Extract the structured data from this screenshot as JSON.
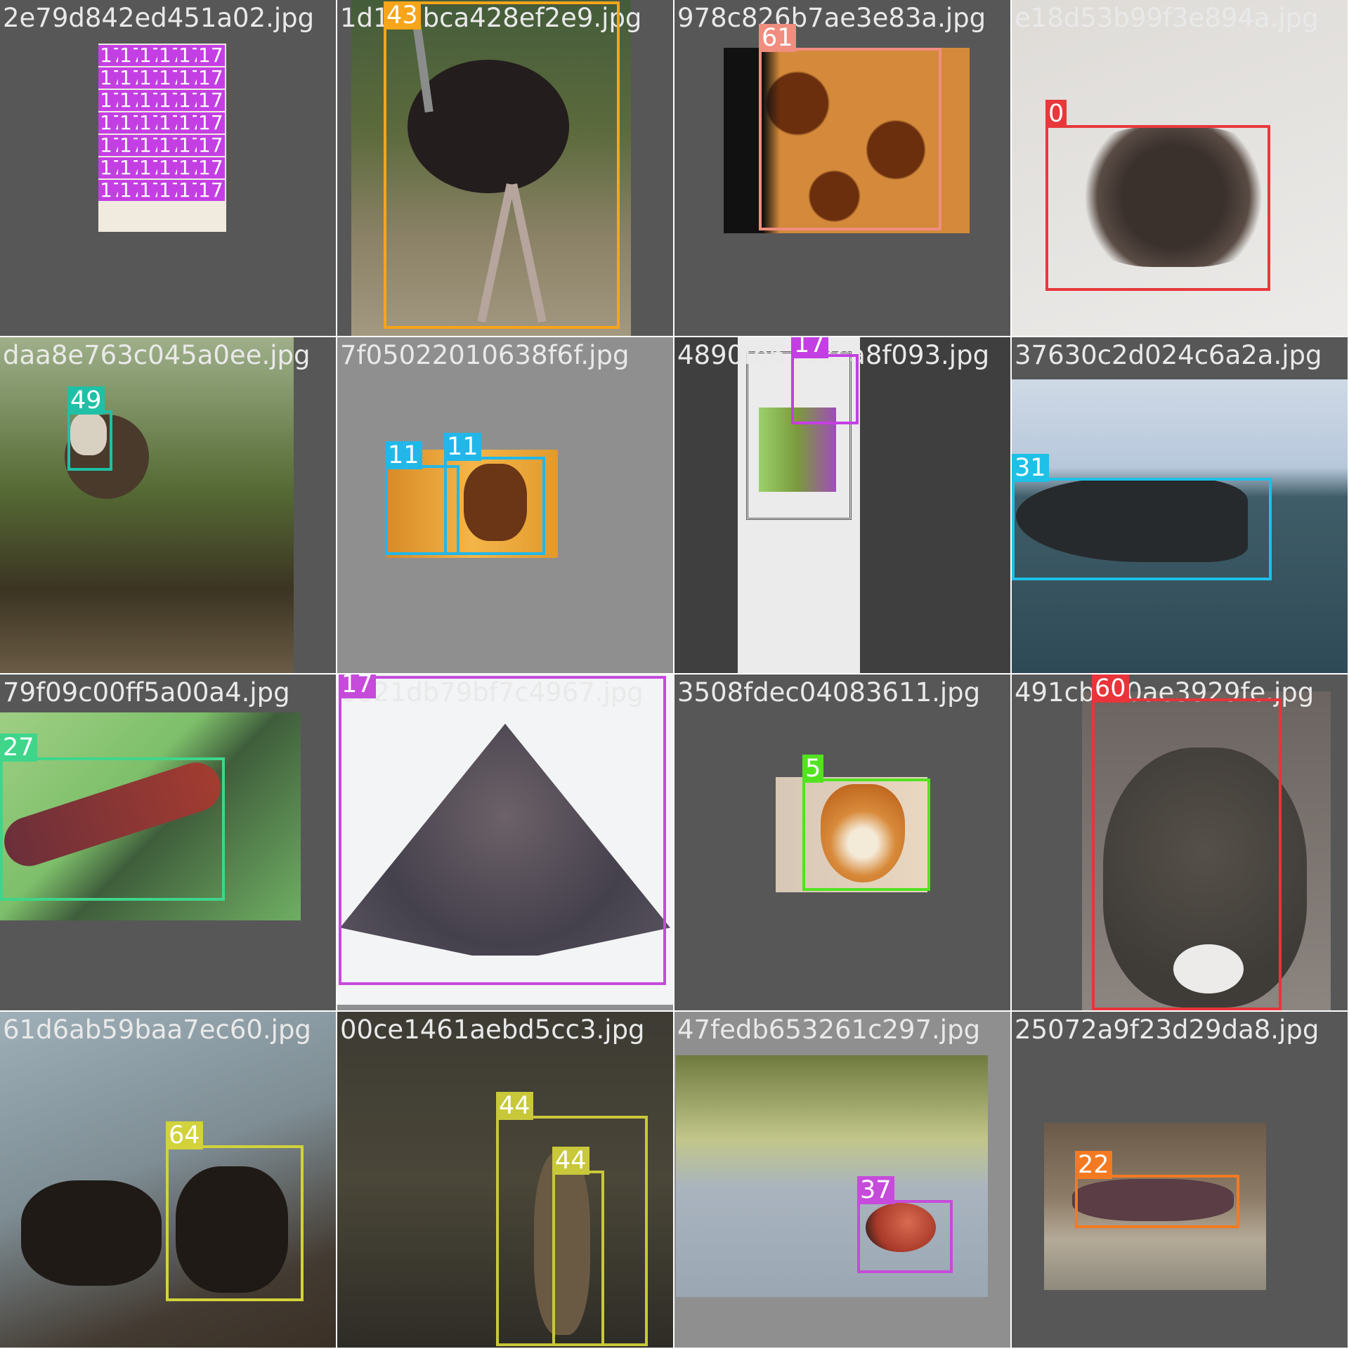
{
  "mosaic": {
    "tiles": [
      {
        "filename": "2e79d842ed451a02.jpg",
        "photo": "page of butterfly specimen images",
        "labels": [
          "17",
          "17",
          "17",
          "17",
          "17",
          "17",
          "17",
          "17",
          "17",
          "17",
          "17",
          "17",
          "17",
          "17",
          "17",
          "17",
          "17",
          "17",
          "17",
          "17",
          "17",
          "17",
          "17",
          "17",
          "17",
          "17",
          "17",
          "17",
          "17",
          "17",
          "17",
          "17",
          "17",
          "17",
          "17",
          "17",
          "17",
          "17",
          "17",
          "17",
          "17",
          "17",
          "17",
          "17"
        ]
      },
      {
        "filename": "1d143bca428ef2e9.jpg",
        "photo": "ostrich",
        "labels": [
          "43"
        ]
      },
      {
        "filename": "978c826b7ae3e83a.jpg",
        "photo": "giraffe skin pattern",
        "labels": [
          "61"
        ]
      },
      {
        "filename": "e18d53b99f3e894a.jpg",
        "photo": "tarantula",
        "labels": [
          "0"
        ]
      },
      {
        "filename": "daa8e763c045a0ee.jpg",
        "photo": "snail on dried flower",
        "labels": [
          "49"
        ]
      },
      {
        "filename": "7f05022010638f6f.jpg",
        "photo": "horses at sunset",
        "labels": [
          "11",
          "11"
        ]
      },
      {
        "filename": "4890fb6253ca8f093.jpg",
        "photo": "butterfly award page",
        "labels": [
          "17"
        ]
      },
      {
        "filename": "37630c2d024c6a2a.jpg",
        "photo": "whale surfacing",
        "labels": [
          "31"
        ]
      },
      {
        "filename": "79f09c00ff5a00a4.jpg",
        "photo": "caterpillar on stem",
        "labels": [
          "27"
        ]
      },
      {
        "filename": "6821db79bf7c4967.jpg",
        "photo": "moth",
        "labels": [
          "17"
        ]
      },
      {
        "filename": "3508fdec04083611.jpg",
        "photo": "fox",
        "labels": [
          "5"
        ]
      },
      {
        "filename": "491cb3c0ae3929fe.jpg",
        "photo": "rabbit",
        "labels": [
          "60"
        ]
      },
      {
        "filename": "61d6ab59baa7ec60.jpg",
        "photo": "chimpanzees",
        "labels": [
          "64"
        ]
      },
      {
        "filename": "00ce1461aebd5cc3.jpg",
        "photo": "ruins",
        "labels": [
          "44",
          "44"
        ]
      },
      {
        "filename": "47fedb653261c297.jpg",
        "photo": "ladybug",
        "labels": [
          "37"
        ]
      },
      {
        "filename": "25072a9f23d29da8.jpg",
        "photo": "hippopotamus",
        "labels": [
          "22"
        ]
      }
    ]
  },
  "colors": {
    "class_17": "#c43fe3",
    "class_43": "#f7a51a",
    "class_61": "#f08d7f",
    "class_0": "#e8383b",
    "class_49": "#1fc0a6",
    "class_11": "#22b7e8",
    "class_31": "#1ec0e8",
    "class_27": "#3fd58b",
    "class_5": "#52e31f",
    "class_60": "#e8343a",
    "class_64": "#d2d23b",
    "class_44": "#c8c83a",
    "class_37": "#c64bdb",
    "class_22": "#f47a22"
  }
}
